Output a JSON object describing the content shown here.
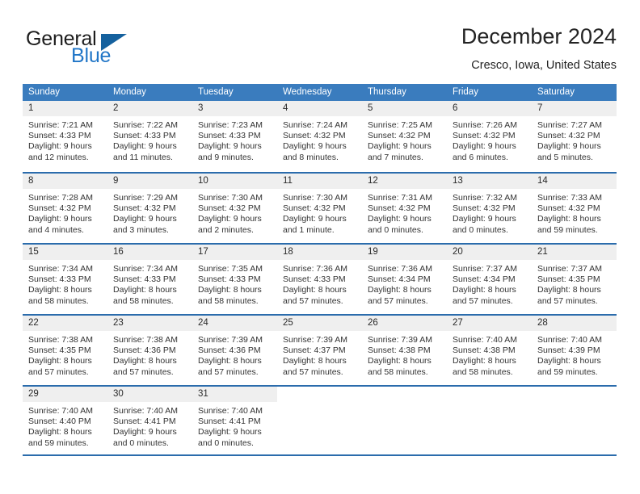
{
  "brand": {
    "name_primary": "General",
    "name_secondary": "Blue",
    "logo_icon": "triangle-logo-icon",
    "accent_color": "#2176c7",
    "triangle_color": "#15619e"
  },
  "header": {
    "title": "December 2024",
    "location": "Cresco, Iowa, United States"
  },
  "calendar": {
    "header_background": "#3a7cbe",
    "header_text_color": "#ffffff",
    "daynum_band_color": "#efefef",
    "row_separator_color": "#2b6cac",
    "weekdays": [
      "Sunday",
      "Monday",
      "Tuesday",
      "Wednesday",
      "Thursday",
      "Friday",
      "Saturday"
    ],
    "weeks": [
      [
        {
          "day": "1",
          "sunrise": "Sunrise: 7:21 AM",
          "sunset": "Sunset: 4:33 PM",
          "daylight_line1": "Daylight: 9 hours",
          "daylight_line2": "and 12 minutes."
        },
        {
          "day": "2",
          "sunrise": "Sunrise: 7:22 AM",
          "sunset": "Sunset: 4:33 PM",
          "daylight_line1": "Daylight: 9 hours",
          "daylight_line2": "and 11 minutes."
        },
        {
          "day": "3",
          "sunrise": "Sunrise: 7:23 AM",
          "sunset": "Sunset: 4:33 PM",
          "daylight_line1": "Daylight: 9 hours",
          "daylight_line2": "and 9 minutes."
        },
        {
          "day": "4",
          "sunrise": "Sunrise: 7:24 AM",
          "sunset": "Sunset: 4:32 PM",
          "daylight_line1": "Daylight: 9 hours",
          "daylight_line2": "and 8 minutes."
        },
        {
          "day": "5",
          "sunrise": "Sunrise: 7:25 AM",
          "sunset": "Sunset: 4:32 PM",
          "daylight_line1": "Daylight: 9 hours",
          "daylight_line2": "and 7 minutes."
        },
        {
          "day": "6",
          "sunrise": "Sunrise: 7:26 AM",
          "sunset": "Sunset: 4:32 PM",
          "daylight_line1": "Daylight: 9 hours",
          "daylight_line2": "and 6 minutes."
        },
        {
          "day": "7",
          "sunrise": "Sunrise: 7:27 AM",
          "sunset": "Sunset: 4:32 PM",
          "daylight_line1": "Daylight: 9 hours",
          "daylight_line2": "and 5 minutes."
        }
      ],
      [
        {
          "day": "8",
          "sunrise": "Sunrise: 7:28 AM",
          "sunset": "Sunset: 4:32 PM",
          "daylight_line1": "Daylight: 9 hours",
          "daylight_line2": "and 4 minutes."
        },
        {
          "day": "9",
          "sunrise": "Sunrise: 7:29 AM",
          "sunset": "Sunset: 4:32 PM",
          "daylight_line1": "Daylight: 9 hours",
          "daylight_line2": "and 3 minutes."
        },
        {
          "day": "10",
          "sunrise": "Sunrise: 7:30 AM",
          "sunset": "Sunset: 4:32 PM",
          "daylight_line1": "Daylight: 9 hours",
          "daylight_line2": "and 2 minutes."
        },
        {
          "day": "11",
          "sunrise": "Sunrise: 7:30 AM",
          "sunset": "Sunset: 4:32 PM",
          "daylight_line1": "Daylight: 9 hours",
          "daylight_line2": "and 1 minute."
        },
        {
          "day": "12",
          "sunrise": "Sunrise: 7:31 AM",
          "sunset": "Sunset: 4:32 PM",
          "daylight_line1": "Daylight: 9 hours",
          "daylight_line2": "and 0 minutes."
        },
        {
          "day": "13",
          "sunrise": "Sunrise: 7:32 AM",
          "sunset": "Sunset: 4:32 PM",
          "daylight_line1": "Daylight: 9 hours",
          "daylight_line2": "and 0 minutes."
        },
        {
          "day": "14",
          "sunrise": "Sunrise: 7:33 AM",
          "sunset": "Sunset: 4:32 PM",
          "daylight_line1": "Daylight: 8 hours",
          "daylight_line2": "and 59 minutes."
        }
      ],
      [
        {
          "day": "15",
          "sunrise": "Sunrise: 7:34 AM",
          "sunset": "Sunset: 4:33 PM",
          "daylight_line1": "Daylight: 8 hours",
          "daylight_line2": "and 58 minutes."
        },
        {
          "day": "16",
          "sunrise": "Sunrise: 7:34 AM",
          "sunset": "Sunset: 4:33 PM",
          "daylight_line1": "Daylight: 8 hours",
          "daylight_line2": "and 58 minutes."
        },
        {
          "day": "17",
          "sunrise": "Sunrise: 7:35 AM",
          "sunset": "Sunset: 4:33 PM",
          "daylight_line1": "Daylight: 8 hours",
          "daylight_line2": "and 58 minutes."
        },
        {
          "day": "18",
          "sunrise": "Sunrise: 7:36 AM",
          "sunset": "Sunset: 4:33 PM",
          "daylight_line1": "Daylight: 8 hours",
          "daylight_line2": "and 57 minutes."
        },
        {
          "day": "19",
          "sunrise": "Sunrise: 7:36 AM",
          "sunset": "Sunset: 4:34 PM",
          "daylight_line1": "Daylight: 8 hours",
          "daylight_line2": "and 57 minutes."
        },
        {
          "day": "20",
          "sunrise": "Sunrise: 7:37 AM",
          "sunset": "Sunset: 4:34 PM",
          "daylight_line1": "Daylight: 8 hours",
          "daylight_line2": "and 57 minutes."
        },
        {
          "day": "21",
          "sunrise": "Sunrise: 7:37 AM",
          "sunset": "Sunset: 4:35 PM",
          "daylight_line1": "Daylight: 8 hours",
          "daylight_line2": "and 57 minutes."
        }
      ],
      [
        {
          "day": "22",
          "sunrise": "Sunrise: 7:38 AM",
          "sunset": "Sunset: 4:35 PM",
          "daylight_line1": "Daylight: 8 hours",
          "daylight_line2": "and 57 minutes."
        },
        {
          "day": "23",
          "sunrise": "Sunrise: 7:38 AM",
          "sunset": "Sunset: 4:36 PM",
          "daylight_line1": "Daylight: 8 hours",
          "daylight_line2": "and 57 minutes."
        },
        {
          "day": "24",
          "sunrise": "Sunrise: 7:39 AM",
          "sunset": "Sunset: 4:36 PM",
          "daylight_line1": "Daylight: 8 hours",
          "daylight_line2": "and 57 minutes."
        },
        {
          "day": "25",
          "sunrise": "Sunrise: 7:39 AM",
          "sunset": "Sunset: 4:37 PM",
          "daylight_line1": "Daylight: 8 hours",
          "daylight_line2": "and 57 minutes."
        },
        {
          "day": "26",
          "sunrise": "Sunrise: 7:39 AM",
          "sunset": "Sunset: 4:38 PM",
          "daylight_line1": "Daylight: 8 hours",
          "daylight_line2": "and 58 minutes."
        },
        {
          "day": "27",
          "sunrise": "Sunrise: 7:40 AM",
          "sunset": "Sunset: 4:38 PM",
          "daylight_line1": "Daylight: 8 hours",
          "daylight_line2": "and 58 minutes."
        },
        {
          "day": "28",
          "sunrise": "Sunrise: 7:40 AM",
          "sunset": "Sunset: 4:39 PM",
          "daylight_line1": "Daylight: 8 hours",
          "daylight_line2": "and 59 minutes."
        }
      ],
      [
        {
          "day": "29",
          "sunrise": "Sunrise: 7:40 AM",
          "sunset": "Sunset: 4:40 PM",
          "daylight_line1": "Daylight: 8 hours",
          "daylight_line2": "and 59 minutes."
        },
        {
          "day": "30",
          "sunrise": "Sunrise: 7:40 AM",
          "sunset": "Sunset: 4:41 PM",
          "daylight_line1": "Daylight: 9 hours",
          "daylight_line2": "and 0 minutes."
        },
        {
          "day": "31",
          "sunrise": "Sunrise: 7:40 AM",
          "sunset": "Sunset: 4:41 PM",
          "daylight_line1": "Daylight: 9 hours",
          "daylight_line2": "and 0 minutes."
        },
        {
          "day": "",
          "sunrise": "",
          "sunset": "",
          "daylight_line1": "",
          "daylight_line2": ""
        },
        {
          "day": "",
          "sunrise": "",
          "sunset": "",
          "daylight_line1": "",
          "daylight_line2": ""
        },
        {
          "day": "",
          "sunrise": "",
          "sunset": "",
          "daylight_line1": "",
          "daylight_line2": ""
        },
        {
          "day": "",
          "sunrise": "",
          "sunset": "",
          "daylight_line1": "",
          "daylight_line2": ""
        }
      ]
    ]
  }
}
